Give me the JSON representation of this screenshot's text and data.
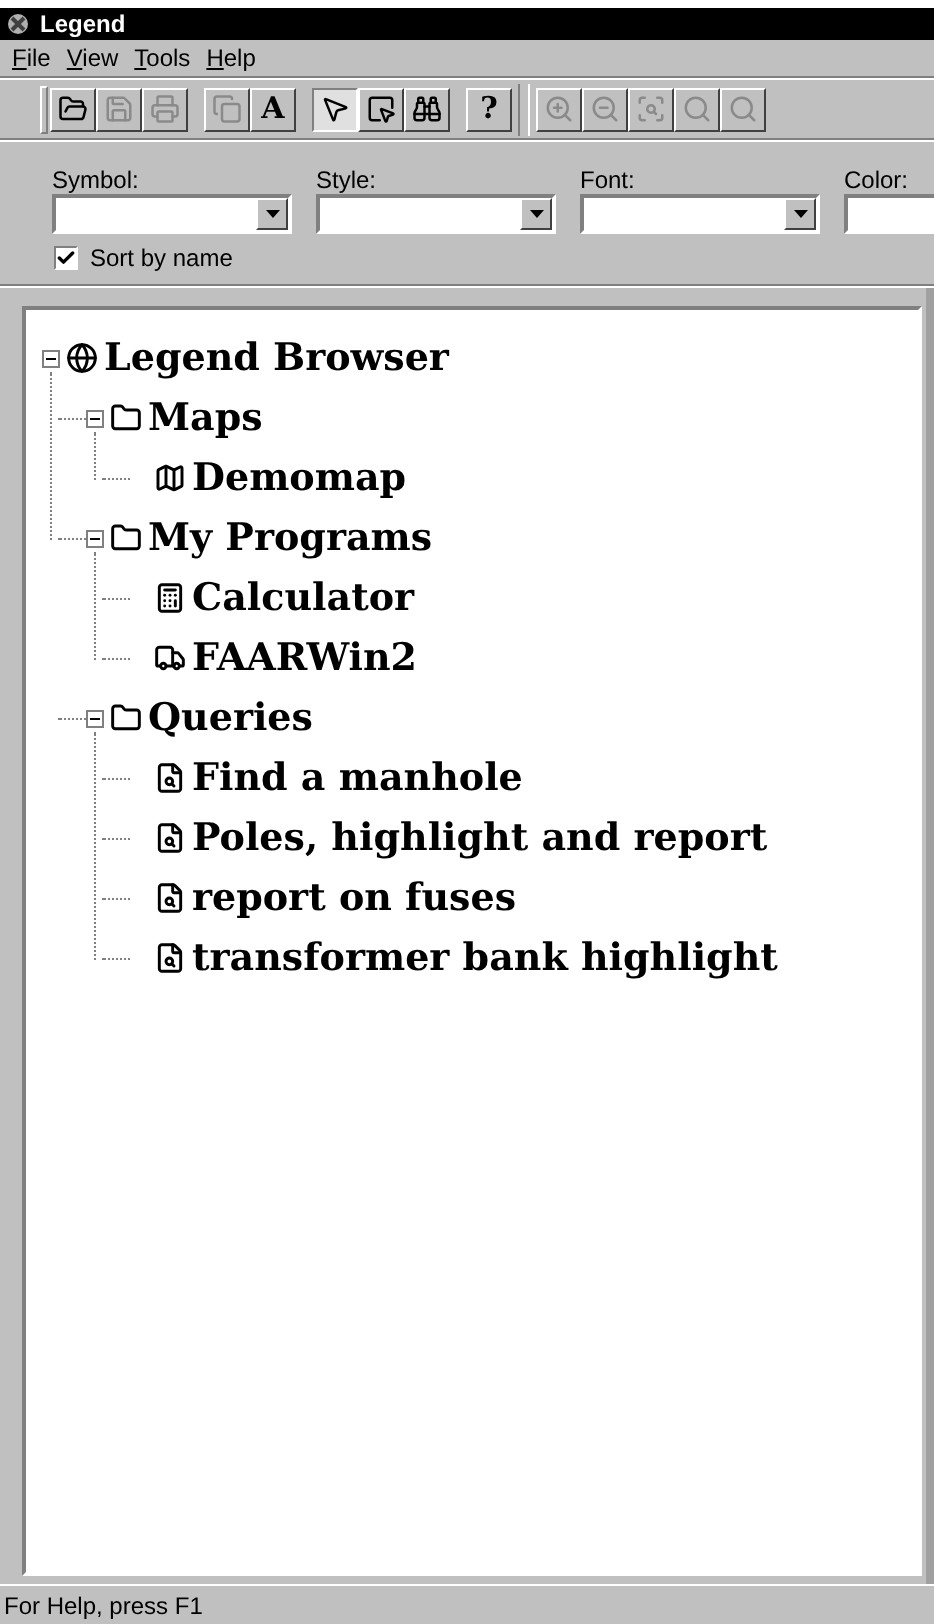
{
  "window": {
    "title": "Legend"
  },
  "menu": [
    {
      "label": "File"
    },
    {
      "label": "View"
    },
    {
      "label": "Tools"
    },
    {
      "label": "Help"
    }
  ],
  "toolbar": [
    {
      "kind": "open",
      "disabled": false,
      "pressed": false
    },
    {
      "kind": "save",
      "disabled": true,
      "pressed": false
    },
    {
      "kind": "print",
      "disabled": true,
      "pressed": false
    },
    {
      "kind": "gap"
    },
    {
      "kind": "copy",
      "disabled": true,
      "pressed": false
    },
    {
      "kind": "text",
      "label": "A",
      "disabled": false,
      "pressed": false
    },
    {
      "kind": "gap"
    },
    {
      "kind": "pointer",
      "disabled": false,
      "pressed": true
    },
    {
      "kind": "select",
      "disabled": false,
      "pressed": false
    },
    {
      "kind": "find",
      "disabled": false,
      "pressed": false
    },
    {
      "kind": "gap"
    },
    {
      "kind": "text",
      "label": "?",
      "disabled": false,
      "pressed": false
    },
    {
      "kind": "separator"
    },
    {
      "kind": "zoom-in",
      "disabled": true,
      "pressed": false
    },
    {
      "kind": "zoom-out",
      "disabled": true,
      "pressed": false
    },
    {
      "kind": "zoom-extent",
      "disabled": true,
      "pressed": false
    },
    {
      "kind": "zoom",
      "disabled": true,
      "pressed": false
    },
    {
      "kind": "zoom-prev",
      "disabled": true,
      "pressed": false
    }
  ],
  "fields": [
    {
      "label": "Symbol:"
    },
    {
      "label": "Style:"
    },
    {
      "label": "Font:"
    },
    {
      "label": "Color:"
    }
  ],
  "sort_by_name": {
    "label": "Sort by name",
    "checked": true
  },
  "tree": [
    {
      "label": "Legend Browser",
      "kind": "globe",
      "expanded": true,
      "children": [
        {
          "label": "Maps",
          "kind": "folder",
          "expanded": true,
          "children": [
            {
              "label": "Demomap",
              "kind": "map"
            }
          ]
        },
        {
          "label": "My Programs",
          "kind": "folder",
          "expanded": true,
          "children": [
            {
              "label": "Calculator",
              "kind": "calculator"
            },
            {
              "label": "FAARWin2",
              "kind": "truck"
            }
          ]
        },
        {
          "label": "Queries",
          "kind": "folder",
          "expanded": true,
          "children": [
            {
              "label": "Find a manhole",
              "kind": "query"
            },
            {
              "label": "Poles, highlight and report",
              "kind": "query"
            },
            {
              "label": "report on fuses",
              "kind": "query"
            },
            {
              "label": "transformer bank highlight",
              "kind": "query"
            }
          ]
        }
      ]
    }
  ],
  "status_bar": {
    "text": "For Help, press F1"
  }
}
